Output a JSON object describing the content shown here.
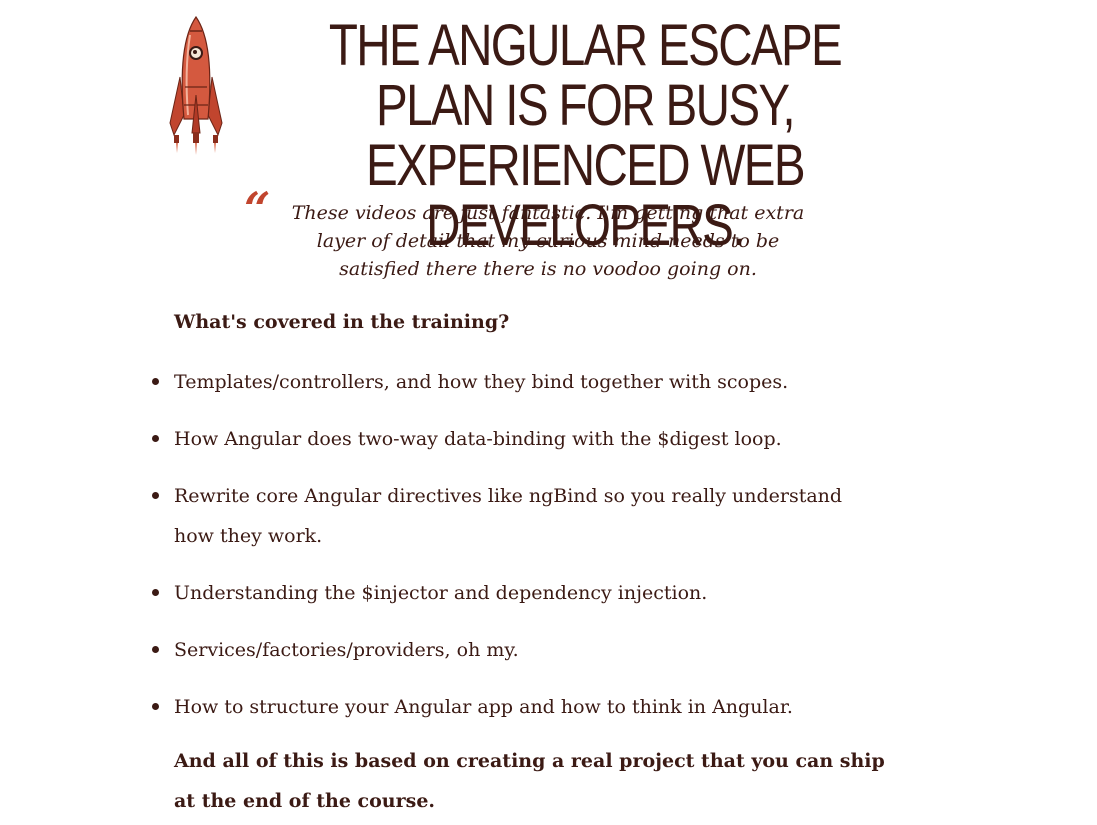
{
  "header": {
    "logo_icon": "rocket-icon",
    "headline_line1": "THE ANGULAR ESCAPE PLAN IS FOR BUSY,",
    "headline_line2": "EXPERIENCED WEB DEVELOPERS."
  },
  "testimonial": {
    "quote_icon": "quote-mark-icon",
    "open_mark": "“",
    "line1": "These videos are just fantastic. I'm getting that extra",
    "line2": "layer of detail that my curious mind needs to be",
    "line3": "satisfied there there is no voodoo going on."
  },
  "training": {
    "heading": "What's covered in the training?",
    "items": [
      {
        "line1": "Templates/controllers, and how they bind together with scopes.",
        "line2": ""
      },
      {
        "line1": "How Angular does two-way data-binding with the $digest loop.",
        "line2": ""
      },
      {
        "line1": "Rewrite core Angular directives like ngBind so you really understand",
        "line2": "how they work."
      },
      {
        "line1": "Understanding the $injector and dependency injection.",
        "line2": ""
      },
      {
        "line1": "Services/factories/providers, oh my.",
        "line2": ""
      },
      {
        "line1": "How to structure your Angular app and how to think in Angular.",
        "line2": ""
      }
    ],
    "closing_line1": "And all of this is based on creating a real project that you can ship",
    "closing_line2": "at the end of the course."
  },
  "colors": {
    "text": "#3b1a14",
    "accent": "#c1452e",
    "background": "#ffffff"
  }
}
